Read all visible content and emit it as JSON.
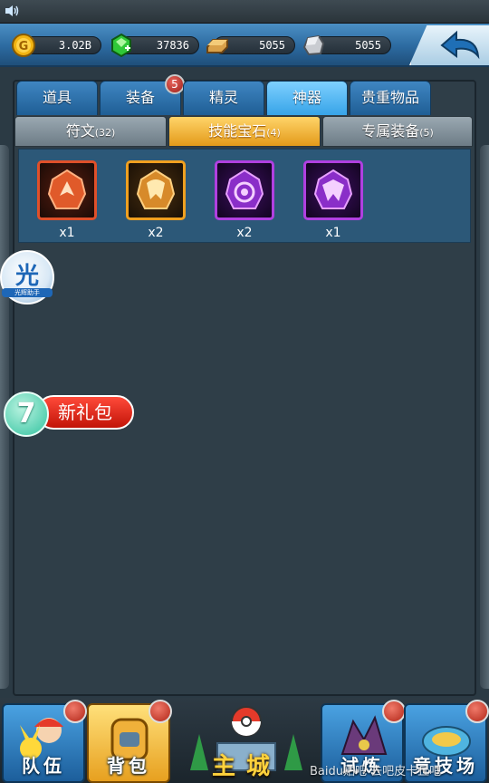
{
  "resources": [
    {
      "name": "gold",
      "icon": "gold-coin-icon",
      "value": "3.02B"
    },
    {
      "name": "gems",
      "icon": "green-gem-icon",
      "value": "37836"
    },
    {
      "name": "bronze",
      "icon": "bronze-ingot-icon",
      "value": "5055"
    },
    {
      "name": "stone",
      "icon": "stone-ore-icon",
      "value": "5055"
    }
  ],
  "tabs": [
    {
      "label": "道具"
    },
    {
      "label": "装备",
      "badge": "5"
    },
    {
      "label": "精灵"
    },
    {
      "label": "神器",
      "active": true
    },
    {
      "label": "贵重物品"
    }
  ],
  "subtabs": [
    {
      "label": "符文",
      "count": "(32)"
    },
    {
      "label": "技能宝石",
      "count": "(4)",
      "active": true
    },
    {
      "label": "专属装备",
      "count": "(5)"
    }
  ],
  "items": [
    {
      "icon": "red-rune-gem-icon",
      "qty": "x1",
      "color": "#e0502a"
    },
    {
      "icon": "orange-rune-gem-icon",
      "qty": "x2",
      "color": "#f0a020"
    },
    {
      "icon": "purple-swirl-gem-icon",
      "qty": "x2",
      "color": "#b040e0"
    },
    {
      "icon": "purple-claw-gem-icon",
      "qty": "x1",
      "color": "#b040e0"
    }
  ],
  "floating": {
    "guang_char": "光",
    "guang_sub": "光辉助手",
    "gift_number": "7",
    "gift_label": "新礼包"
  },
  "nav": [
    {
      "label": "队伍"
    },
    {
      "label": "背包",
      "active": true
    },
    {
      "label": "主城"
    },
    {
      "label": "试炼"
    },
    {
      "label": "竞技场"
    }
  ],
  "watermark": "Baidu贴吧 去吧皮卡丘吧"
}
